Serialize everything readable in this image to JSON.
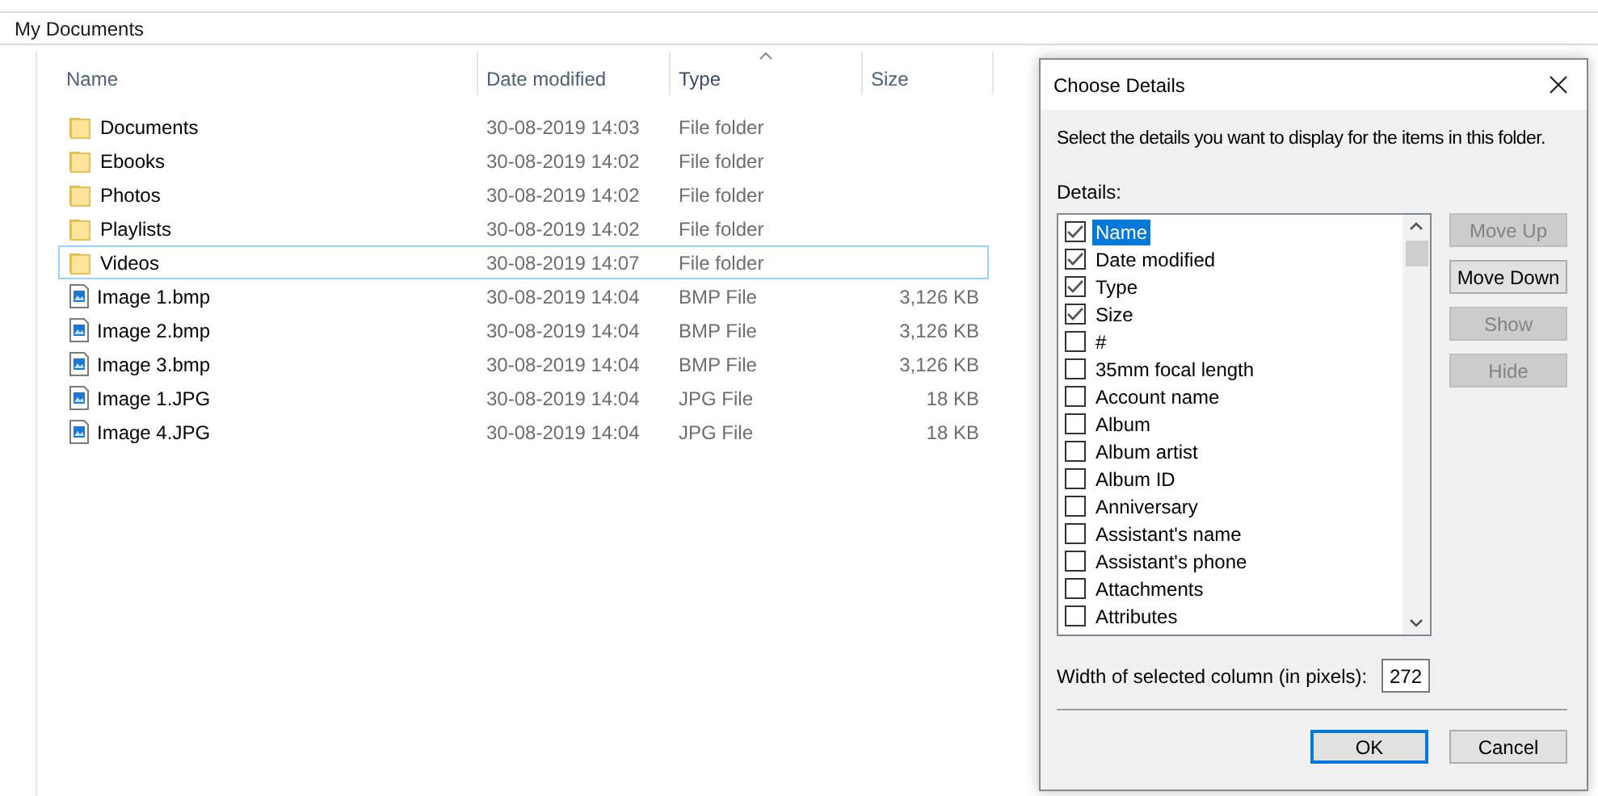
{
  "address_bar": {
    "path": "My Documents"
  },
  "file_list": {
    "columns": [
      {
        "label": "Name",
        "sorted": false
      },
      {
        "label": "Date modified",
        "sorted": false
      },
      {
        "label": "Type",
        "sorted": true
      },
      {
        "label": "Size",
        "sorted": false
      }
    ],
    "rows": [
      {
        "kind": "folder",
        "name": "Documents",
        "date": "30-08-2019 14:03",
        "type": "File folder",
        "focused": false
      },
      {
        "kind": "folder",
        "name": "Ebooks",
        "date": "30-08-2019 14:02",
        "type": "File folder",
        "focused": false
      },
      {
        "kind": "folder",
        "name": "Photos",
        "date": "30-08-2019 14:02",
        "type": "File folder",
        "focused": false
      },
      {
        "kind": "folder",
        "name": "Playlists",
        "date": "30-08-2019 14:02",
        "type": "File folder",
        "focused": false
      },
      {
        "kind": "folder",
        "name": "Videos",
        "date": "30-08-2019 14:07",
        "type": "File folder",
        "focused": true
      },
      {
        "kind": "image",
        "name": "Image 1.bmp",
        "date": "30-08-2019 14:04",
        "type": "BMP File",
        "size": "3,126 KB",
        "focused": false
      },
      {
        "kind": "image",
        "name": "Image 2.bmp",
        "date": "30-08-2019 14:04",
        "type": "BMP File",
        "size": "3,126 KB",
        "focused": false
      },
      {
        "kind": "image",
        "name": "Image 3.bmp",
        "date": "30-08-2019 14:04",
        "type": "BMP File",
        "size": "3,126 KB",
        "focused": false
      },
      {
        "kind": "image",
        "name": "Image 1.JPG",
        "date": "30-08-2019 14:04",
        "type": "JPG File",
        "size": "18 KB",
        "focused": false
      },
      {
        "kind": "image",
        "name": "Image 4.JPG",
        "date": "30-08-2019 14:04",
        "type": "JPG File",
        "size": "18 KB",
        "focused": false
      }
    ]
  },
  "dialog": {
    "title": "Choose Details",
    "instructions": "Select the details you want to display for the items in this folder.",
    "details_label": "Details:",
    "items": [
      {
        "label": "Name",
        "checked": true,
        "selected": true
      },
      {
        "label": "Date modified",
        "checked": true,
        "selected": false
      },
      {
        "label": "Type",
        "checked": true,
        "selected": false
      },
      {
        "label": "Size",
        "checked": true,
        "selected": false
      },
      {
        "label": "#",
        "checked": false,
        "selected": false
      },
      {
        "label": "35mm focal length",
        "checked": false,
        "selected": false
      },
      {
        "label": "Account name",
        "checked": false,
        "selected": false
      },
      {
        "label": "Album",
        "checked": false,
        "selected": false
      },
      {
        "label": "Album artist",
        "checked": false,
        "selected": false
      },
      {
        "label": "Album ID",
        "checked": false,
        "selected": false
      },
      {
        "label": "Anniversary",
        "checked": false,
        "selected": false
      },
      {
        "label": "Assistant's name",
        "checked": false,
        "selected": false
      },
      {
        "label": "Assistant's phone",
        "checked": false,
        "selected": false
      },
      {
        "label": "Attachments",
        "checked": false,
        "selected": false
      },
      {
        "label": "Attributes",
        "checked": false,
        "selected": false
      }
    ],
    "side_buttons": [
      {
        "label": "Move Up",
        "disabled": true
      },
      {
        "label": "Move Down",
        "disabled": false
      },
      {
        "label": "Show",
        "disabled": true
      },
      {
        "label": "Hide",
        "disabled": true
      }
    ],
    "width_label": "Width of selected column (in pixels):",
    "width_value": "272",
    "footer_buttons": [
      {
        "label": "OK",
        "default": true
      },
      {
        "label": "Cancel",
        "default": false
      }
    ]
  }
}
